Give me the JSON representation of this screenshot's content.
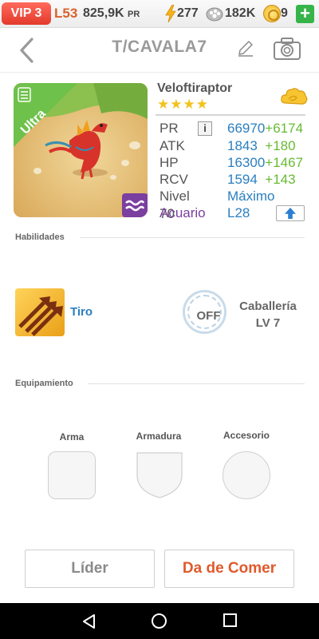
{
  "status_bar": {
    "vip": "VIP 3",
    "level": "L53",
    "power": "825,9K",
    "power_unit": "PR",
    "energy": "277",
    "food": "182K",
    "gems": "9",
    "add_label": "+"
  },
  "header": {
    "title": "T/CAVALA7"
  },
  "monster": {
    "name": "Veloftiraptor",
    "stars": "★★★★",
    "rarity": "Ultra",
    "stats": {
      "pr_label": "PR",
      "pr_value": "66970",
      "pr_bonus": "+6174",
      "atk_label": "ATK",
      "atk_value": "1843",
      "atk_bonus": "+180",
      "hp_label": "HP",
      "hp_value": "16300",
      "hp_bonus": "+1467",
      "rcv_label": "RCV",
      "rcv_value": "1594",
      "rcv_bonus": "+143",
      "level_label": "Nivel 70",
      "level_value": "Máximo",
      "habitat_label": "Acuario",
      "habitat_value": "L28"
    }
  },
  "skills": {
    "section_label": "Habilidades",
    "skill_name": "Tiro",
    "toggle_label": "OFF",
    "cavalry_name": "Caballería",
    "cavalry_level": "LV 7"
  },
  "equipment": {
    "section_label": "Equipamiento",
    "weapon": "Arma",
    "armor": "Armadura",
    "accessory": "Accesorio"
  },
  "actions": {
    "leader": "Líder",
    "feed": "Da de Comer"
  },
  "colors": {
    "accent_blue": "#2a7fbf",
    "bonus_green": "#66bb33",
    "feed_orange": "#e05a2b",
    "habitat_purple": "#7b3fa0",
    "ultra_green": "#6ec14a",
    "vip_red": "#e23a2c"
  }
}
